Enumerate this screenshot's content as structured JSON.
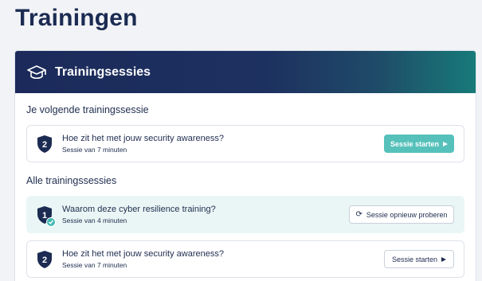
{
  "page": {
    "title": "Trainingen"
  },
  "card": {
    "title": "Trainingsessies",
    "icon": "graduation-cap-icon"
  },
  "next_section": {
    "title": "Je volgende trainingssessie",
    "session": {
      "number": "2",
      "title": "Hoe zit het met jouw security awareness?",
      "subtitle": "Sessie van 7 minuten",
      "button": "Sessie starten"
    }
  },
  "all_section": {
    "title": "Alle trainingssessies",
    "sessions": [
      {
        "number": "1",
        "title": "Waarom deze cyber resilience training?",
        "subtitle": "Sessie van 4 minuten",
        "button": "Sessie opnieuw proberen",
        "completed": true
      },
      {
        "number": "2",
        "title": "Hoe zit het met jouw security awareness?",
        "subtitle": "Sessie van 7 minuten",
        "button": "Sessie starten",
        "completed": false
      }
    ]
  },
  "colors": {
    "header_start": "#1b2a5a",
    "header_end": "#177a79",
    "accent": "#56c1bb",
    "shield": "#1b2b52"
  }
}
